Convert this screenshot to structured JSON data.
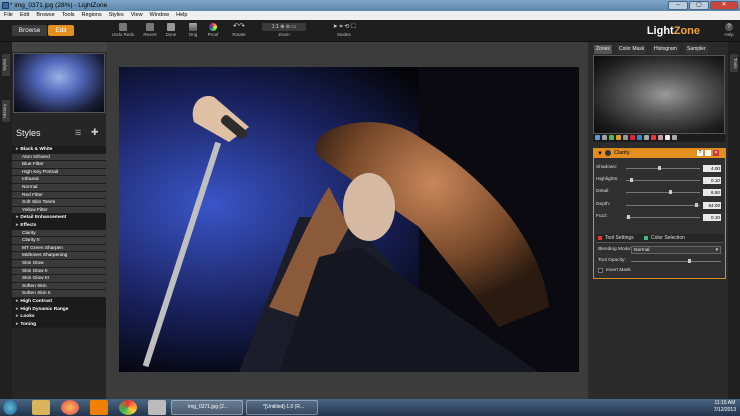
{
  "window": {
    "title": "* img_0371.jpg (28%) - LightZone"
  },
  "menu": [
    "File",
    "Edit",
    "Browse",
    "Tools",
    "Regions",
    "Styles",
    "View",
    "Window",
    "Help"
  ],
  "toolbar": {
    "browse_label": "Browse",
    "edit_label": "Edit",
    "buttons": [
      "Undo Redo",
      "Revert",
      "Done",
      "Orig",
      "Proof",
      "Rotate",
      "Zoom",
      "Modes"
    ],
    "help_label": "Help",
    "brand_main": "Light",
    "brand_accent": "Zone"
  },
  "left_tabs": [
    "Styles",
    "History"
  ],
  "right_tabs": [
    "Tools"
  ],
  "styles": {
    "title": "Styles",
    "rows": [
      {
        "label": "Black & White",
        "type": "cat"
      },
      {
        "label": "Aton Infrared",
        "type": "item"
      },
      {
        "label": "Blue Filter",
        "type": "item"
      },
      {
        "label": "High Key Portrait",
        "type": "item"
      },
      {
        "label": "Infrared",
        "type": "item"
      },
      {
        "label": "Normal",
        "type": "item"
      },
      {
        "label": "Red Filter",
        "type": "item"
      },
      {
        "label": "Soft Skin Tones",
        "type": "item"
      },
      {
        "label": "Yellow Filter",
        "type": "item"
      },
      {
        "label": "Detail Enhancement",
        "type": "cat"
      },
      {
        "label": "Effects",
        "type": "cat"
      },
      {
        "label": "Clarity",
        "type": "item"
      },
      {
        "label": "Clarity II",
        "type": "item"
      },
      {
        "label": "MT Green Sharpen",
        "type": "item"
      },
      {
        "label": "Midtones Sharpening",
        "type": "item"
      },
      {
        "label": "Skin Glow",
        "type": "item"
      },
      {
        "label": "Skin Glow II",
        "type": "item"
      },
      {
        "label": "Skin Glow III",
        "type": "item"
      },
      {
        "label": "Soften Skin",
        "type": "item"
      },
      {
        "label": "Soften Skin II",
        "type": "item"
      },
      {
        "label": "High Contrast",
        "type": "cat"
      },
      {
        "label": "High Dynamic Range",
        "type": "cat"
      },
      {
        "label": "Looks",
        "type": "cat"
      },
      {
        "label": "Toning",
        "type": "cat"
      }
    ]
  },
  "inspector_tabs": [
    "Zones",
    "Color Mask",
    "Histogram",
    "Sampler"
  ],
  "clarity": {
    "title": "Clarity",
    "sliders": [
      {
        "label": "Shadows:",
        "value": "4.00",
        "pos": 0.45
      },
      {
        "label": "Highlights:",
        "value": "0.10",
        "pos": 0.05
      },
      {
        "label": "Detail:",
        "value": "6.50",
        "pos": 0.6
      },
      {
        "label": "Depth:",
        "value": "64.00",
        "pos": 0.97
      },
      {
        "label": "Fuzz:",
        "value": "0.10",
        "pos": 0.02
      }
    ],
    "subtabs": [
      "Tool Settings",
      "Color Selection"
    ],
    "blending_label": "Blending Mode:",
    "blending_value": "Normal",
    "opacity_label": "Tool Opacity:",
    "opacity_pos": 0.65,
    "invert_label": "Invert Mask"
  },
  "taskbar": {
    "tasks": [
      "img_0371.jpg (2...",
      "*[Untitled]-1.0 (R..."
    ],
    "time": "11:15 AM",
    "date": "7/12/2013"
  },
  "colors": {
    "accent": "#e48f1f",
    "panel": "#2b2b2b"
  }
}
